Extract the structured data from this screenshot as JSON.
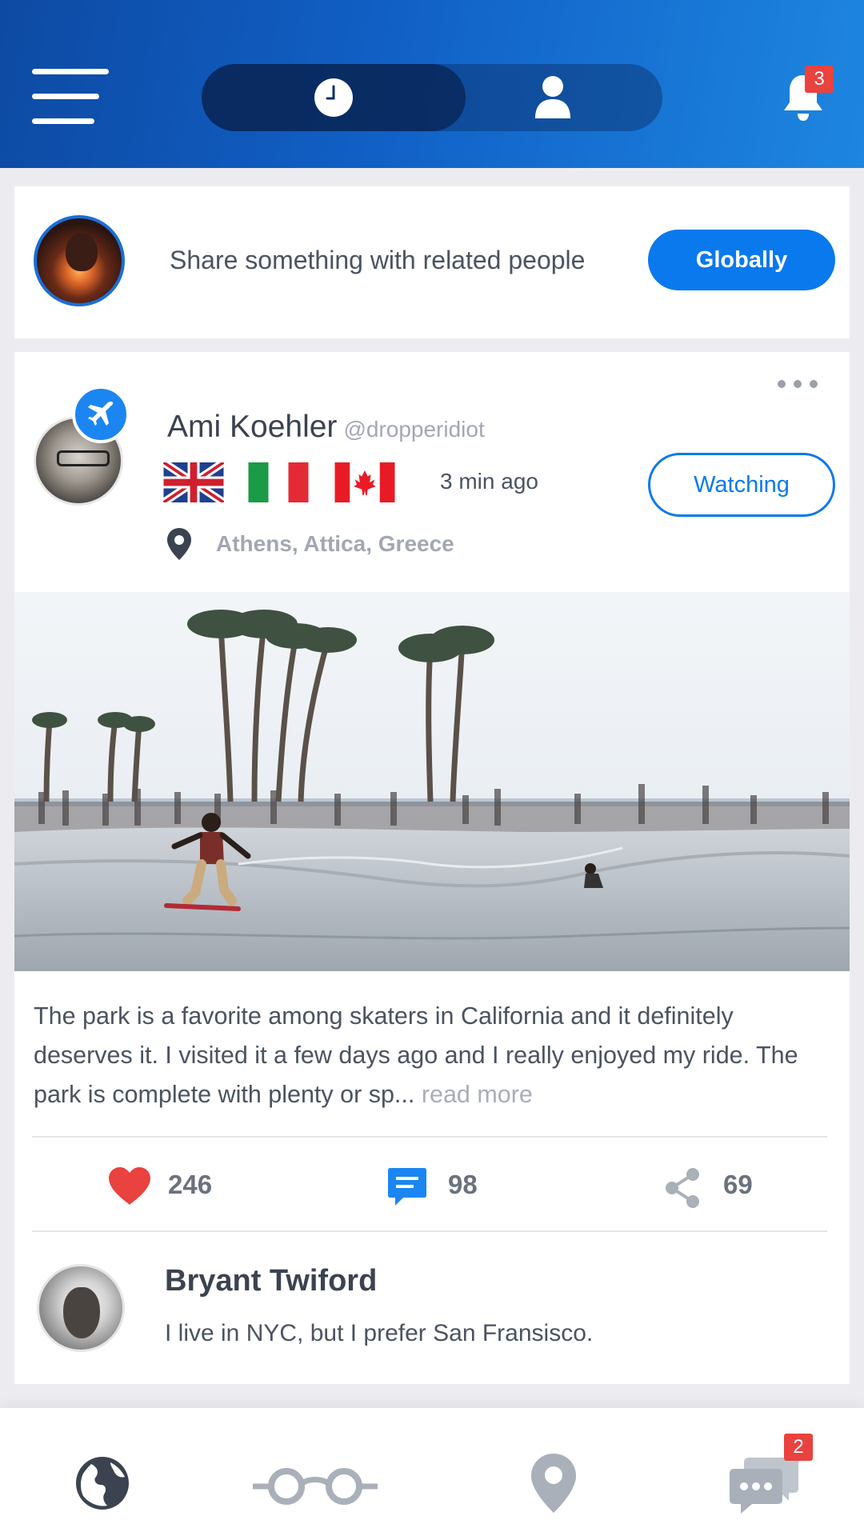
{
  "header": {
    "menu_icon": "hamburger-icon",
    "segments": [
      {
        "icon": "clock-icon",
        "active": true
      },
      {
        "icon": "user-icon",
        "active": false
      }
    ],
    "notifications": {
      "icon": "bell-icon",
      "count": "3"
    }
  },
  "composer": {
    "placeholder": "Share something with related people",
    "scope_button": "Globally"
  },
  "post": {
    "author": {
      "name": "Ami Koehler",
      "handle": "@dropperidiot",
      "badge_icon": "airplane-icon"
    },
    "flags": [
      "flag-uk-icon",
      "flag-italy-icon",
      "flag-canada-icon"
    ],
    "time": "3 min ago",
    "follow_button": "Watching",
    "location": "Athens, Attica, Greece",
    "image": "skatepark-photo",
    "text": "The park is a favorite among skaters in California and it definitely deserves it. I visited it a few days ago and I really enjoyed my ride. The park is complete with plenty or sp...",
    "read_more": "read more",
    "stats": {
      "likes": "246",
      "comments": "98",
      "shares": "69"
    },
    "top_comment": {
      "name": "Bryant Twiford",
      "text": "I live in NYC, but I prefer San Fransisco."
    }
  },
  "bottom_nav": {
    "items": [
      {
        "icon": "globe-icon",
        "active": true
      },
      {
        "icon": "glasses-icon",
        "active": false
      },
      {
        "icon": "map-pin-icon",
        "active": false
      },
      {
        "icon": "chat-icon",
        "active": false,
        "badge": "2"
      }
    ]
  },
  "colors": {
    "primary": "#0a79ee",
    "header_dark": "#0d4aa3",
    "header_light": "#1d86e0",
    "badge": "#e9423f",
    "like": "#e9423f"
  }
}
